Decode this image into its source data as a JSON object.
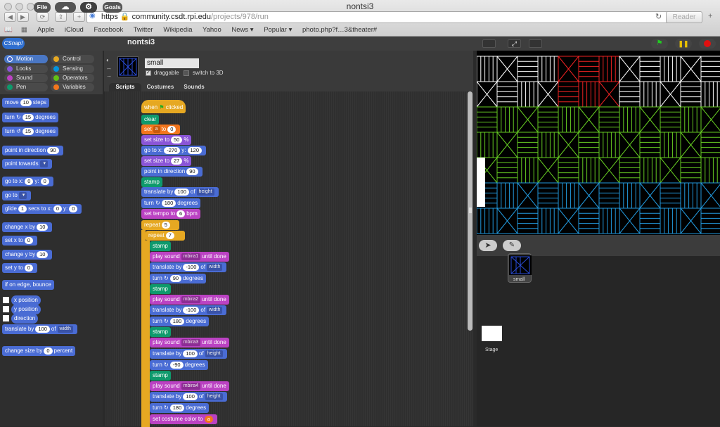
{
  "browser": {
    "window_title": "nontsi3",
    "url_scheme": "https",
    "url_host": "community.csdt.rpi.edu",
    "url_path": "/projects/978/run",
    "reader": "Reader",
    "bookmarks": [
      "Apple",
      "iCloud",
      "Facebook",
      "Twitter",
      "Wikipedia",
      "Yahoo",
      "News ▾",
      "Popular ▾",
      "photo.php?f…3&theater#"
    ]
  },
  "snap": {
    "file": "File",
    "goals": "Goals",
    "project_name": "nontsi3",
    "categories": [
      {
        "label": "Motion",
        "color": "#4a6cd4"
      },
      {
        "label": "Looks",
        "color": "#8a55d7"
      },
      {
        "label": "Sound",
        "color": "#bb42c3"
      },
      {
        "label": "Pen",
        "color": "#0e9a6c"
      },
      {
        "label": "Control",
        "color": "#e6a822"
      },
      {
        "label": "Sensing",
        "color": "#0494dc"
      },
      {
        "label": "Operators",
        "color": "#62c213"
      },
      {
        "label": "Variables",
        "color": "#f3761d"
      }
    ],
    "selected_category": "Motion",
    "palette": {
      "move": "move",
      "move_val": "10",
      "steps": "steps",
      "turn": "turn",
      "turn_cw_val": "15",
      "degrees": "degrees",
      "turn_ccw_val": "15",
      "point_dir": "point in direction",
      "point_dir_val": "90",
      "point_towards": "point towards",
      "go_to_xy": "go to x:",
      "go_x": "0",
      "y_lbl": "y:",
      "go_y": "0",
      "go_to": "go to",
      "glide": "glide",
      "glide_secs": "1",
      "glide_mid": "secs to x:",
      "glide_x": "0",
      "glide_y": "0",
      "change_x": "change x by",
      "change_x_val": "10",
      "set_x": "set x to",
      "set_x_val": "0",
      "change_y": "change y by",
      "change_y_val": "10",
      "set_y": "set y to",
      "set_y_val": "0",
      "bounce": "if on edge, bounce",
      "x_position": "x position",
      "y_position": "y position",
      "direction": "direction",
      "translate": "translate by",
      "translate_val": "100",
      "of": "of",
      "width": "width",
      "change_size": "change size by",
      "change_size_val": "0",
      "percent": "percent"
    },
    "sprite": {
      "name": "small",
      "draggable": "draggable",
      "switch_3d": "switch to 3D"
    },
    "tabs": [
      "Scripts",
      "Costumes",
      "Sounds"
    ],
    "script": {
      "when": "when",
      "clicked": "clicked",
      "clear": "clear",
      "set": "set",
      "var_a": "a",
      "to": "to",
      "var_val": "0",
      "set_size": "set size to",
      "size1": "50",
      "pct": "%",
      "go_x": "-270",
      "go_y": "120",
      "size2": "27",
      "dir": "90",
      "stamp": "stamp",
      "translate_by": "translate by",
      "t1": "100",
      "of": "of",
      "height": "height",
      "turn_deg": "180",
      "set_tempo": "set tempo to",
      "tempo": "6",
      "bpm": "bpm",
      "repeat": "repeat",
      "rep1": "5",
      "rep2": "7",
      "play_sound": "play sound",
      "until_done": "until done",
      "snd1": "mbira1",
      "snd2": "mbira2",
      "snd3": "mbira3",
      "snd4": "mbira4",
      "t_neg": "-100",
      "width": "width",
      "turn90": "90",
      "turn_neg90": "-90",
      "set_costume_color": "set costume color to",
      "costume_var": "a"
    },
    "corral": {
      "sprite_label": "small",
      "stage_label": "Stage"
    }
  }
}
